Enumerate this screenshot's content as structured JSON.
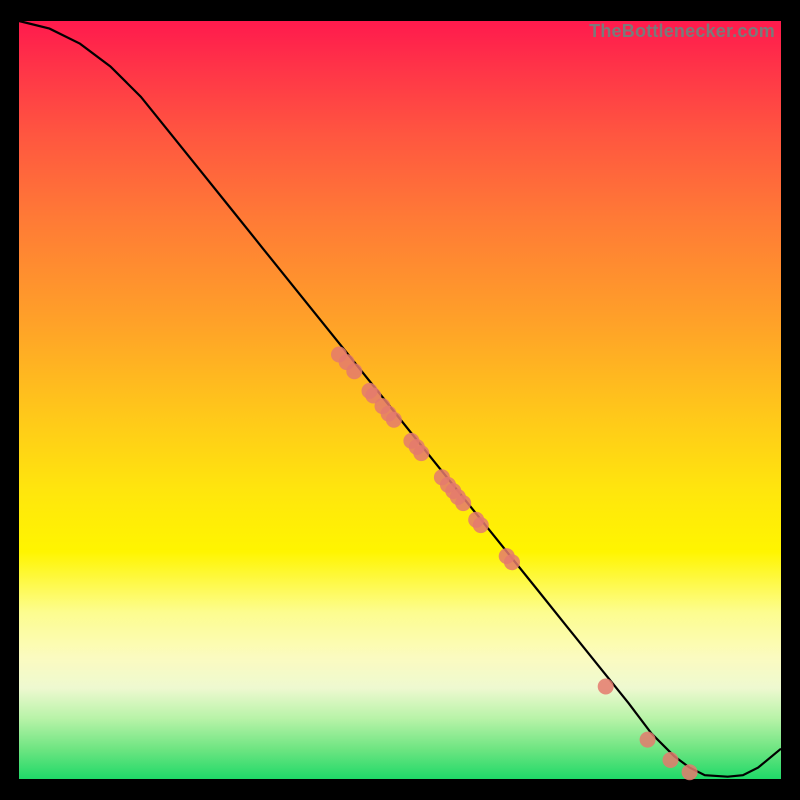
{
  "watermark": "TheBottlenecker.com",
  "chart_data": {
    "type": "line",
    "title": "",
    "xlabel": "",
    "ylabel": "",
    "xlim": [
      0,
      100
    ],
    "ylim": [
      0,
      100
    ],
    "series": [
      {
        "name": "curve",
        "x": [
          0,
          4,
          8,
          12,
          16,
          20,
          24,
          28,
          32,
          36,
          40,
          44,
          48,
          52,
          56,
          60,
          64,
          68,
          72,
          76,
          80,
          83,
          86,
          88,
          90,
          93,
          95,
          97,
          100
        ],
        "y": [
          100,
          99,
          97,
          94,
          90,
          85,
          80,
          75,
          70,
          65,
          60,
          55,
          50,
          45,
          40,
          35,
          30,
          25,
          20,
          15,
          10,
          6,
          3,
          1.5,
          0.5,
          0.3,
          0.5,
          1.5,
          4
        ]
      }
    ],
    "scatter_points": {
      "name": "markers",
      "x": [
        42,
        43,
        44,
        46,
        46.5,
        47.7,
        48.5,
        49.2,
        51.5,
        52.2,
        52.8,
        55.5,
        56.3,
        57.0,
        57.6,
        58.3,
        60.0,
        60.6,
        64.0,
        64.7,
        77.0,
        82.5,
        85.5,
        88.0
      ],
      "y": [
        56,
        55,
        53.8,
        51.2,
        50.6,
        49.2,
        48.2,
        47.4,
        44.6,
        43.8,
        43.0,
        39.8,
        38.8,
        38.0,
        37.2,
        36.4,
        34.2,
        33.5,
        29.4,
        28.6,
        12.2,
        5.2,
        2.5,
        0.9
      ]
    },
    "marker_radius_px": 8
  }
}
